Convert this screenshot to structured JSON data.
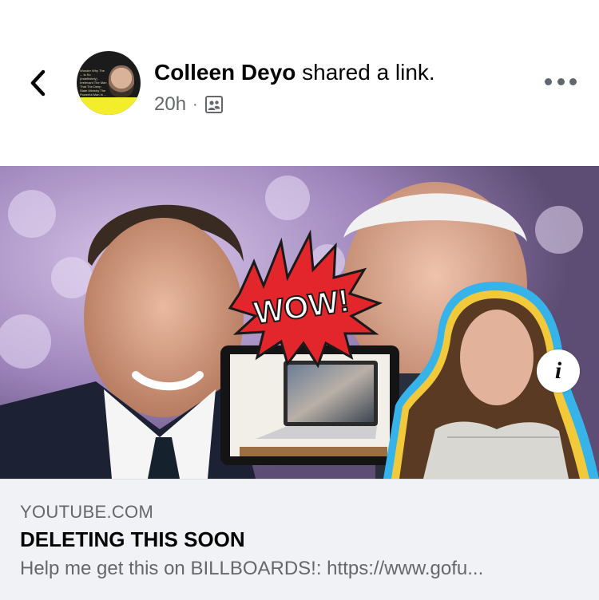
{
  "post": {
    "author": "Colleen Deyo",
    "action": " shared a link.",
    "timestamp": "20h",
    "separator": "·",
    "audience_icon": "friends-icon",
    "avatar_banner_text": "Wonder Why The ... Is So (Indefinitely) Irrelevant The Man That The Deep State Ministry The Powerful Man In ... Behind The ... World Order"
  },
  "header": {
    "back_icon": "chevron-left-icon",
    "more_icon": "more-options-icon"
  },
  "link": {
    "image_overlay_text": "WOW!",
    "info_icon": "info-icon",
    "info_label": "i",
    "domain": "YOUTUBE.COM",
    "title": "DELETING THIS SOON",
    "description": "Help me get this on BILLBOARDS!: https://www.gofu..."
  },
  "colors": {
    "secondary_text": "#65676b",
    "footer_bg": "#f0f2f5",
    "primary_text": "#050505",
    "wow_red": "#e3262b",
    "highlight_border": "#36b3e8"
  }
}
